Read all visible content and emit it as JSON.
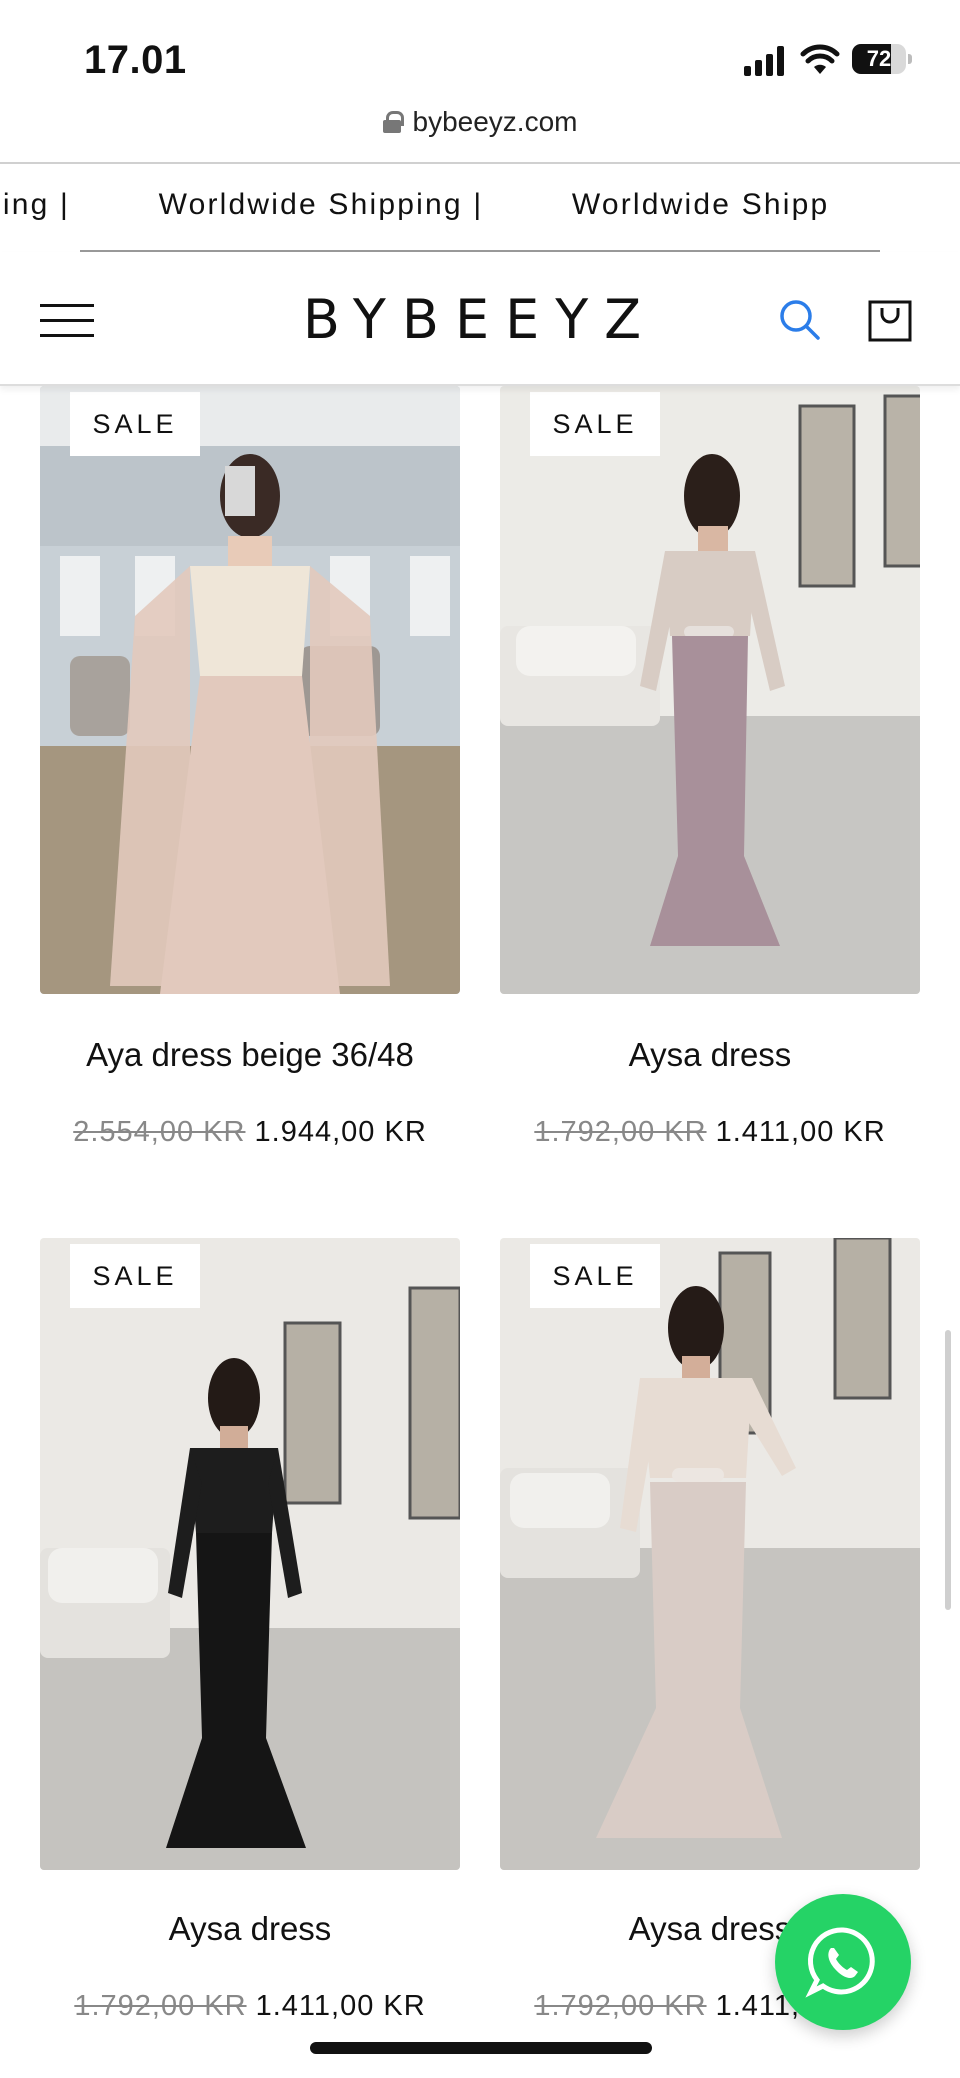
{
  "status_bar": {
    "time": "17.01",
    "battery_level": "72",
    "icons": [
      "cellular-signal-icon",
      "wifi-icon",
      "battery-icon"
    ]
  },
  "browser": {
    "url": "bybeeyz.com"
  },
  "announcement": {
    "items": [
      "ping |",
      "Worldwide Shipping |",
      "Worldwide Shipp"
    ]
  },
  "header": {
    "logo": "BYBEEYZ",
    "icons": [
      "menu-icon",
      "search-icon",
      "shopping-bag-icon"
    ],
    "accent_color": "#2b7de9"
  },
  "products": [
    {
      "title": "Aya dress beige 36/48",
      "badge": "SALE",
      "old_price": "2.554,00 KR",
      "price": "1.944,00 KR",
      "colors": {
        "dress": "#e2c9bd",
        "bodice": "#efe6d8",
        "bg": "#c8d0d6"
      }
    },
    {
      "title": "Aysa dress",
      "badge": "SALE",
      "old_price": "1.792,00 KR",
      "price": "1.411,00 KR",
      "colors": {
        "dress": "#a8909a",
        "bodice": "#d8ccc4",
        "bg": "#ecebe7"
      }
    },
    {
      "title": "Aysa dress",
      "badge": "SALE",
      "old_price": "1.792,00 KR",
      "price": "1.411,00 KR",
      "colors": {
        "dress": "#151515",
        "bodice": "#1d1d1d",
        "bg": "#ebe9e5"
      }
    },
    {
      "title": "Aysa dress",
      "badge": "SALE",
      "old_price": "1.792,00 KR",
      "price": "1.411,00 KR",
      "colors": {
        "dress": "#d9ccc6",
        "bodice": "#e7dcd3",
        "bg": "#ebe9e5"
      }
    }
  ],
  "whatsapp": {
    "icon": "whatsapp-icon",
    "color": "#25d366"
  }
}
